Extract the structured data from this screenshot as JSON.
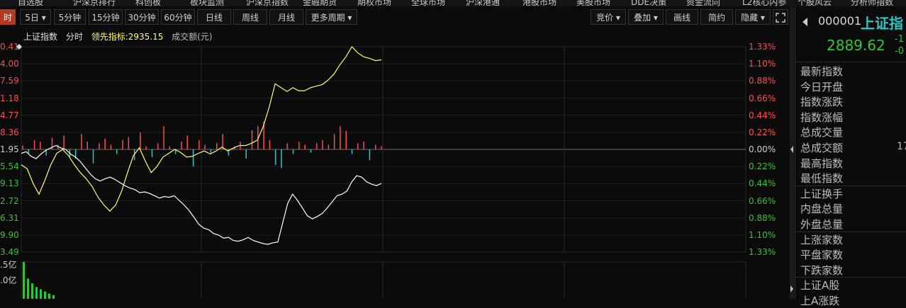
{
  "top_menu": [
    "自选股",
    "沪深京排行",
    "科创板",
    "板块监测",
    "沪深京指数",
    "金融期货",
    "期权市场",
    "全球市场",
    "沪深港通",
    "港股市场",
    "美股市场",
    "DDE决策",
    "资金流向",
    "L2核心内参",
    "个股风云",
    "分析师指数"
  ],
  "toolbar": {
    "left_tab": "时",
    "period_tabs": [
      "5日 ▾",
      "5分钟",
      "15分钟",
      "30分钟",
      "60分钟",
      "日线",
      "周线",
      "月线",
      "更多周期 ▾"
    ],
    "right_tabs": [
      "竞价 ▾",
      "叠加 ▾",
      "画线",
      "简约",
      "隐藏 ▾"
    ],
    "expand_icon": "expand-icon"
  },
  "chart_info": {
    "index_name": "上证指数",
    "mode": "分时",
    "leading_label": "领先指标:2935.15",
    "volume_label": "成交额(元)"
  },
  "colors": {
    "up": "#ff4b4b",
    "down": "#33c433",
    "price_line": "#ffffff",
    "leading_line": "#ffff66",
    "bg": "#0b0b0b",
    "grid": "#2a2a2a",
    "accent": "#b23a1e",
    "cyan": "#2ec4c4"
  },
  "chart_data": {
    "type": "line",
    "title": "",
    "y_left_ticks": [
      "0.41",
      "4.00",
      "7.59",
      "1.18",
      "4.77",
      "8.36",
      "1.95",
      "5.54",
      "9.13",
      "2.72",
      "6.31",
      "9.90",
      "3.49"
    ],
    "y_right_ticks": [
      "1.33%",
      "1.10%",
      "0.88%",
      "0.66%",
      "0.44%",
      "0.22%",
      "0.00%",
      "0.22%",
      "0.44%",
      "0.66%",
      "0.88%",
      "1.10%",
      "1.33%"
    ],
    "volume_ticks": [
      ".5亿",
      ".0亿"
    ],
    "series": [],
    "price_values": [
      -0.05,
      -0.03,
      -0.09,
      -0.12,
      -0.06,
      -0.01,
      0.02,
      0.05,
      0.02,
      0.0,
      -0.06,
      -0.1,
      -0.16,
      -0.24,
      -0.32,
      -0.38,
      -0.41,
      -0.38,
      -0.36,
      -0.39,
      -0.43,
      -0.47,
      -0.5,
      -0.52,
      -0.56,
      -0.55,
      -0.57,
      -0.6,
      -0.63,
      -0.61,
      -0.62,
      -0.6,
      -0.66,
      -0.72,
      -0.79,
      -0.88,
      -0.97,
      -1.02,
      -1.04,
      -1.09,
      -1.11,
      -1.15,
      -1.14,
      -1.18,
      -1.19,
      -1.17,
      -1.14,
      -1.18,
      -1.2,
      -1.22,
      -1.23,
      -1.21,
      -1.2,
      -0.95,
      -0.7,
      -0.58,
      -0.66,
      -0.76,
      -0.86,
      -0.9,
      -0.87,
      -0.83,
      -0.76,
      -0.68,
      -0.6,
      -0.58,
      -0.54,
      -0.42,
      -0.34,
      -0.36,
      -0.42,
      -0.45,
      -0.47,
      -0.44
    ],
    "leading_values": [
      -0.2,
      -0.25,
      -0.44,
      -0.58,
      -0.4,
      -0.2,
      -0.05,
      0.0,
      -0.08,
      -0.2,
      -0.3,
      -0.38,
      -0.48,
      -0.62,
      -0.72,
      -0.8,
      -0.72,
      -0.54,
      -0.3,
      -0.08,
      0.02,
      -0.15,
      -0.3,
      -0.22,
      -0.1,
      -0.05,
      0.0,
      -0.04,
      -0.1,
      -0.09,
      -0.05,
      -0.02,
      -0.06,
      -0.02,
      0.03,
      -0.02,
      0.02,
      0.05,
      0.05,
      0.08,
      0.12,
      0.3,
      0.55,
      0.85,
      0.8,
      0.75,
      0.8,
      0.76,
      0.76,
      0.8,
      0.82,
      0.84,
      0.9,
      0.98,
      1.1,
      1.2,
      1.33,
      1.25,
      1.2,
      1.18,
      1.15,
      1.16
    ],
    "bar_values": [
      0.05,
      -0.05,
      0.12,
      0.1,
      -0.08,
      0.15,
      0.06,
      0.18,
      -0.1,
      -0.12,
      0.2,
      0.1,
      -0.18,
      0.08,
      0.14,
      0.06,
      -0.06,
      0.12,
      0.16,
      -0.14,
      0.22,
      0.04,
      -0.1,
      0.08,
      0.3,
      0.04,
      -0.06,
      0.1,
      0.18,
      -0.22,
      0.12,
      0.06,
      -0.05,
      0.08,
      0.2,
      -0.08,
      0.04,
      0.1,
      -0.12,
      0.25,
      0.3,
      0.36,
      0.12,
      -0.2,
      -0.24,
      0.08,
      -0.06,
      0.1,
      0.06,
      -0.04,
      0.08,
      0.12,
      0.06,
      0.2,
      0.3,
      0.24,
      -0.06,
      0.08,
      0.1,
      -0.14,
      0.06,
      0.04
    ],
    "volume_values": [
      1.0,
      0.55,
      0.42,
      0.32,
      0.26,
      0.2,
      0.14,
      0.1
    ]
  },
  "side_panel": {
    "code": "000001",
    "name": "上证指",
    "price": "2889.62",
    "change_a": "-1",
    "change_b": "-0",
    "rows": [
      "最新指数",
      "今日开盘",
      "指数涨跌",
      "指数涨幅",
      "总成交量",
      "总成交额",
      "最高指数",
      "最低指数",
      "上证换手",
      "内盘总量",
      "外盘总量",
      "上涨家数",
      "平盘家数",
      "下跌家数",
      "上证A股",
      "上A涨跌"
    ],
    "amount_value": "17"
  }
}
